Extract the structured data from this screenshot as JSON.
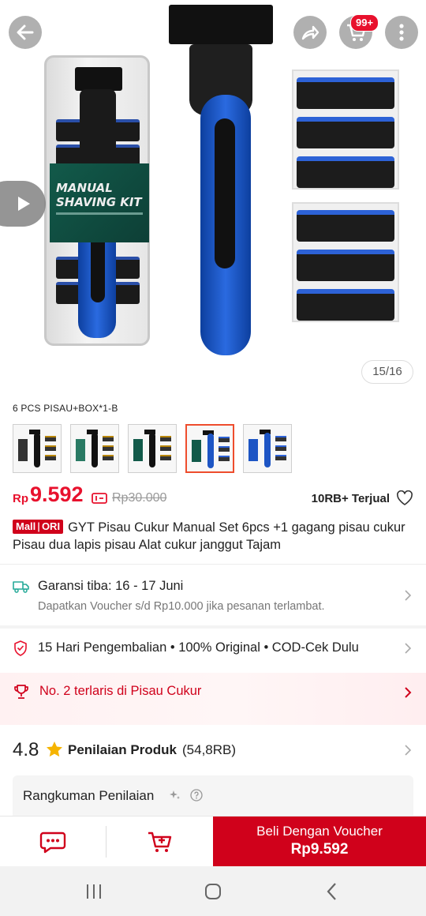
{
  "header": {
    "back_icon": "arrow-left-icon",
    "share_icon": "share-icon",
    "cart_icon": "cart-icon",
    "cart_badge": "99+",
    "more_icon": "more-vertical-icon"
  },
  "gallery": {
    "play_icon": "play-icon",
    "counter": "15/16",
    "label_line1": "MANUAL",
    "label_line2": "SHAVING KIT"
  },
  "variant": {
    "label": "6 PCS PISAU+BOX*1-B",
    "thumbnails": [
      "variant-1",
      "variant-2",
      "variant-3",
      "variant-4",
      "variant-5"
    ],
    "selected_index": 3
  },
  "price": {
    "currency": "Rp",
    "current": "9.592",
    "original": "Rp30.000",
    "sold": "10RB+ Terjual"
  },
  "product": {
    "badge_mall": "Mall",
    "badge_ori": "ORI",
    "title": "GYT Pisau Cukur Manual Set 6pcs +1 gagang pisau cukur Pisau dua lapis pisau Alat cukur janggut Tajam"
  },
  "shipping": {
    "title": "Garansi tiba: 16 - 17 Juni",
    "subtitle": "Dapatkan Voucher s/d Rp10.000 jika pesanan terlambat."
  },
  "guarantee": {
    "text": "15 Hari Pengembalian  •  100% Original  •  COD-Cek Dulu"
  },
  "ranking": {
    "text": "No. 2 terlaris di Pisau Cukur"
  },
  "rating": {
    "score": "4.8",
    "label": "Penilaian Produk",
    "count": "(54,8RB)"
  },
  "summary": {
    "title": "Rangkuman Penilaian"
  },
  "action_bar": {
    "chat_icon": "chat-icon",
    "add_cart_icon": "add-to-cart-icon",
    "buy_line1": "Beli Dengan Voucher",
    "buy_line2": "Rp9.592"
  },
  "colors": {
    "accent": "#d0011b",
    "price": "#e8112d"
  }
}
